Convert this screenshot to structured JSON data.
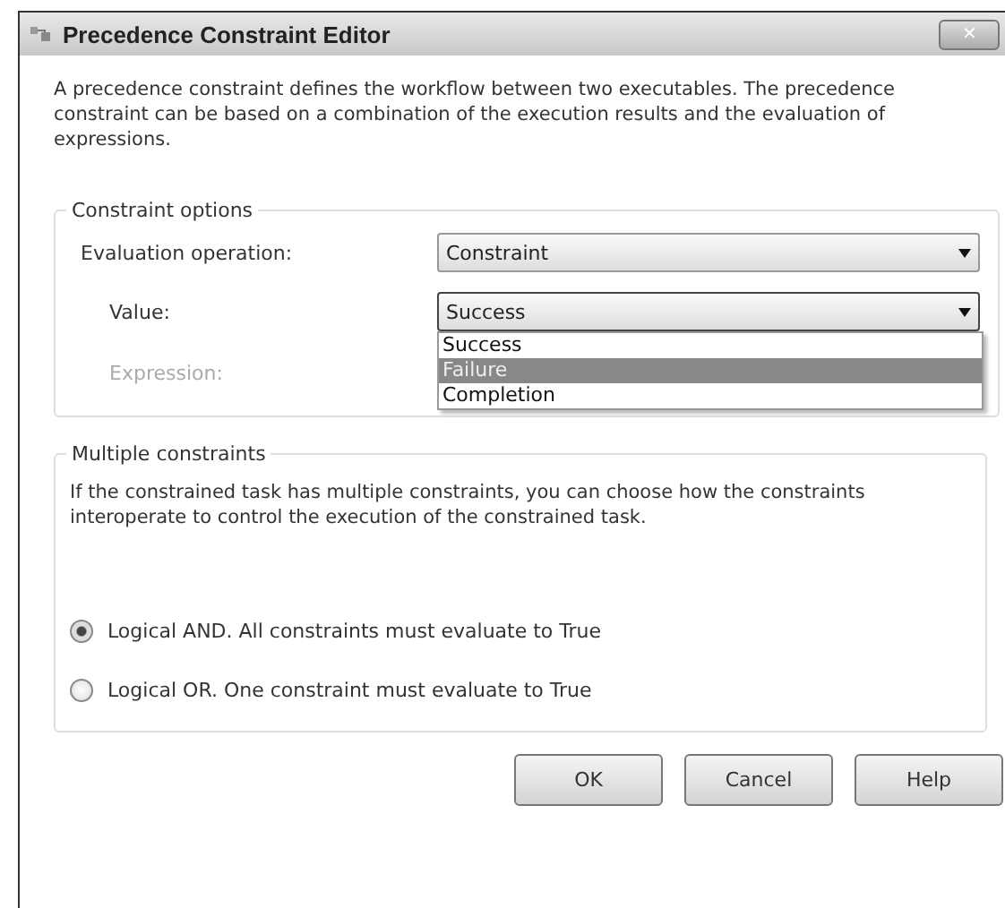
{
  "window": {
    "title": "Precedence Constraint Editor",
    "close": "✕"
  },
  "description": "A precedence constraint defines the workflow between two executables. The precedence constraint can be based on a combination of the execution results and the evaluation of expressions.",
  "constraint_options": {
    "legend": "Constraint options",
    "evaluation_operation": {
      "label": "Evaluation operation:",
      "value": "Constraint"
    },
    "value": {
      "label": "Value:",
      "value": "Success",
      "expanded": true,
      "options": [
        {
          "label": "Success",
          "highlighted": false
        },
        {
          "label": "Failure",
          "highlighted": true
        },
        {
          "label": "Completion",
          "highlighted": false
        }
      ]
    },
    "expression": {
      "label": "Expression:",
      "disabled": true
    }
  },
  "multiple_constraints": {
    "legend": "Multiple constraints",
    "description": "If the constrained task has multiple constraints, you can choose how the constraints interoperate to control the execution of the constrained task.",
    "options": [
      {
        "label": "Logical AND. All constraints must evaluate to True",
        "selected": true
      },
      {
        "label": "Logical OR. One constraint must evaluate to True",
        "selected": false
      }
    ]
  },
  "buttons": [
    "OK",
    "Cancel",
    "Help"
  ]
}
